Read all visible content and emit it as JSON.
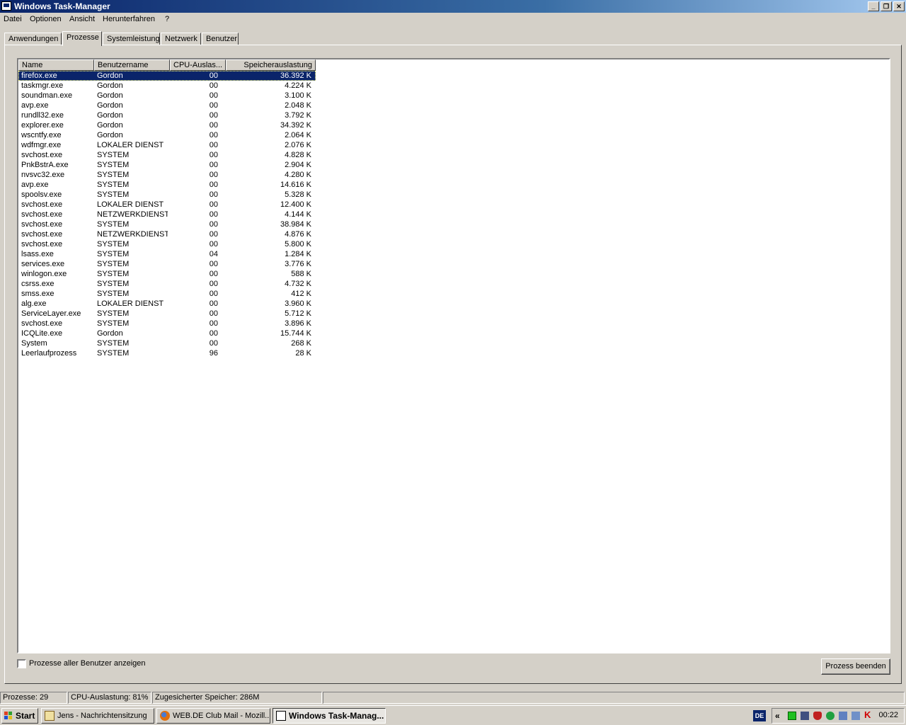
{
  "window": {
    "title": "Windows Task-Manager",
    "controls": {
      "minimize": "_",
      "maximize": "❐",
      "close": "✕"
    }
  },
  "menu": [
    "Datei",
    "Optionen",
    "Ansicht",
    "Herunterfahren",
    "?"
  ],
  "tabs": [
    "Anwendungen",
    "Prozesse",
    "Systemleistung",
    "Netzwerk",
    "Benutzer"
  ],
  "active_tab": "Prozesse",
  "columns": [
    "Name",
    "Benutzername",
    "CPU-Auslas...",
    "Speicherauslastung"
  ],
  "processes": [
    {
      "name": "firefox.exe",
      "user": "Gordon",
      "cpu": "00",
      "mem": "36.392 K"
    },
    {
      "name": "taskmgr.exe",
      "user": "Gordon",
      "cpu": "00",
      "mem": "4.224 K"
    },
    {
      "name": "soundman.exe",
      "user": "Gordon",
      "cpu": "00",
      "mem": "3.100 K"
    },
    {
      "name": "avp.exe",
      "user": "Gordon",
      "cpu": "00",
      "mem": "2.048 K"
    },
    {
      "name": "rundll32.exe",
      "user": "Gordon",
      "cpu": "00",
      "mem": "3.792 K"
    },
    {
      "name": "explorer.exe",
      "user": "Gordon",
      "cpu": "00",
      "mem": "34.392 K"
    },
    {
      "name": "wscntfy.exe",
      "user": "Gordon",
      "cpu": "00",
      "mem": "2.064 K"
    },
    {
      "name": "wdfmgr.exe",
      "user": "LOKALER DIENST",
      "cpu": "00",
      "mem": "2.076 K"
    },
    {
      "name": "svchost.exe",
      "user": "SYSTEM",
      "cpu": "00",
      "mem": "4.828 K"
    },
    {
      "name": "PnkBstrA.exe",
      "user": "SYSTEM",
      "cpu": "00",
      "mem": "2.904 K"
    },
    {
      "name": "nvsvc32.exe",
      "user": "SYSTEM",
      "cpu": "00",
      "mem": "4.280 K"
    },
    {
      "name": "avp.exe",
      "user": "SYSTEM",
      "cpu": "00",
      "mem": "14.616 K"
    },
    {
      "name": "spoolsv.exe",
      "user": "SYSTEM",
      "cpu": "00",
      "mem": "5.328 K"
    },
    {
      "name": "svchost.exe",
      "user": "LOKALER DIENST",
      "cpu": "00",
      "mem": "12.400 K"
    },
    {
      "name": "svchost.exe",
      "user": "NETZWERKDIENST",
      "cpu": "00",
      "mem": "4.144 K"
    },
    {
      "name": "svchost.exe",
      "user": "SYSTEM",
      "cpu": "00",
      "mem": "38.984 K"
    },
    {
      "name": "svchost.exe",
      "user": "NETZWERKDIENST",
      "cpu": "00",
      "mem": "4.876 K"
    },
    {
      "name": "svchost.exe",
      "user": "SYSTEM",
      "cpu": "00",
      "mem": "5.800 K"
    },
    {
      "name": "lsass.exe",
      "user": "SYSTEM",
      "cpu": "04",
      "mem": "1.284 K"
    },
    {
      "name": "services.exe",
      "user": "SYSTEM",
      "cpu": "00",
      "mem": "3.776 K"
    },
    {
      "name": "winlogon.exe",
      "user": "SYSTEM",
      "cpu": "00",
      "mem": "588 K"
    },
    {
      "name": "csrss.exe",
      "user": "SYSTEM",
      "cpu": "00",
      "mem": "4.732 K"
    },
    {
      "name": "smss.exe",
      "user": "SYSTEM",
      "cpu": "00",
      "mem": "412 K"
    },
    {
      "name": "alg.exe",
      "user": "LOKALER DIENST",
      "cpu": "00",
      "mem": "3.960 K"
    },
    {
      "name": "ServiceLayer.exe",
      "user": "SYSTEM",
      "cpu": "00",
      "mem": "5.712 K"
    },
    {
      "name": "svchost.exe",
      "user": "SYSTEM",
      "cpu": "00",
      "mem": "3.896 K"
    },
    {
      "name": "ICQLite.exe",
      "user": "Gordon",
      "cpu": "00",
      "mem": "15.744 K"
    },
    {
      "name": "System",
      "user": "SYSTEM",
      "cpu": "00",
      "mem": "268 K"
    },
    {
      "name": "Leerlaufprozess",
      "user": "SYSTEM",
      "cpu": "96",
      "mem": "28 K"
    }
  ],
  "selected_process": "firefox.exe",
  "show_all_users": {
    "label": "Prozesse aller Benutzer anzeigen",
    "checked": false
  },
  "end_process_button": "Prozess beenden",
  "status": {
    "processes": "Prozesse: 29",
    "cpu": "CPU-Auslastung: 81%",
    "commit": "Zugesicherter Speicher: 286M"
  },
  "taskbar": {
    "start": "Start",
    "tasks": [
      {
        "label": "Jens - Nachrichtensitzung",
        "icon": "messenger-icon",
        "active": false
      },
      {
        "label": "WEB.DE Club Mail - Mozill...",
        "icon": "firefox-icon",
        "active": false
      },
      {
        "label": "Windows Task-Manag...",
        "icon": "taskmanager-icon",
        "active": true
      }
    ],
    "language": "DE",
    "tray_chevron": "«",
    "clock": "00:22"
  },
  "colors": {
    "title_start": "#0a246a",
    "title_end": "#a6caf0",
    "face": "#d4d0c8",
    "selection": "#0a246a"
  }
}
